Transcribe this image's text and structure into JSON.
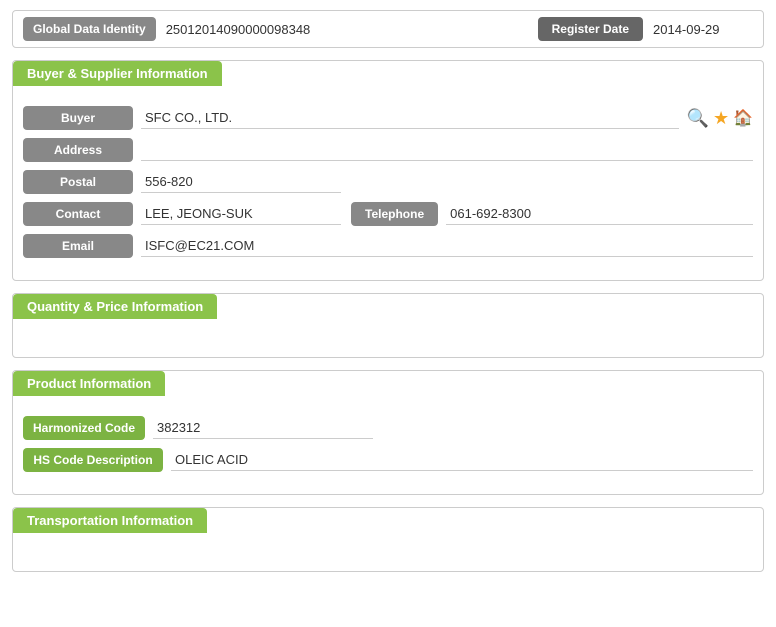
{
  "topBar": {
    "gdiLabel": "Global Data Identity",
    "gdiValue": "25012014090000098348",
    "regLabel": "Register Date",
    "regValue": "2014-09-29"
  },
  "buyerSupplier": {
    "title": "Buyer & Supplier Information",
    "fields": {
      "buyerLabel": "Buyer",
      "buyerValue": "SFC CO., LTD.",
      "addressLabel": "Address",
      "addressValue": "",
      "postalLabel": "Postal",
      "postalValue": "556-820",
      "contactLabel": "Contact",
      "contactValue": "LEE, JEONG-SUK",
      "telephoneLabel": "Telephone",
      "telephoneValue": "061-692-8300",
      "emailLabel": "Email",
      "emailValue": "ISFC@EC21.COM"
    }
  },
  "quantityPrice": {
    "title": "Quantity & Price Information"
  },
  "productInfo": {
    "title": "Product Information",
    "fields": {
      "harmonizedCodeLabel": "Harmonized Code",
      "harmonizedCodeValue": "382312",
      "hsDescLabel": "HS Code Description",
      "hsDescValue": "OLEIC ACID"
    }
  },
  "transportInfo": {
    "title": "Transportation Information"
  },
  "icons": {
    "searchIcon": "🔍",
    "starIcon": "★",
    "homeIcon": "🏠"
  }
}
